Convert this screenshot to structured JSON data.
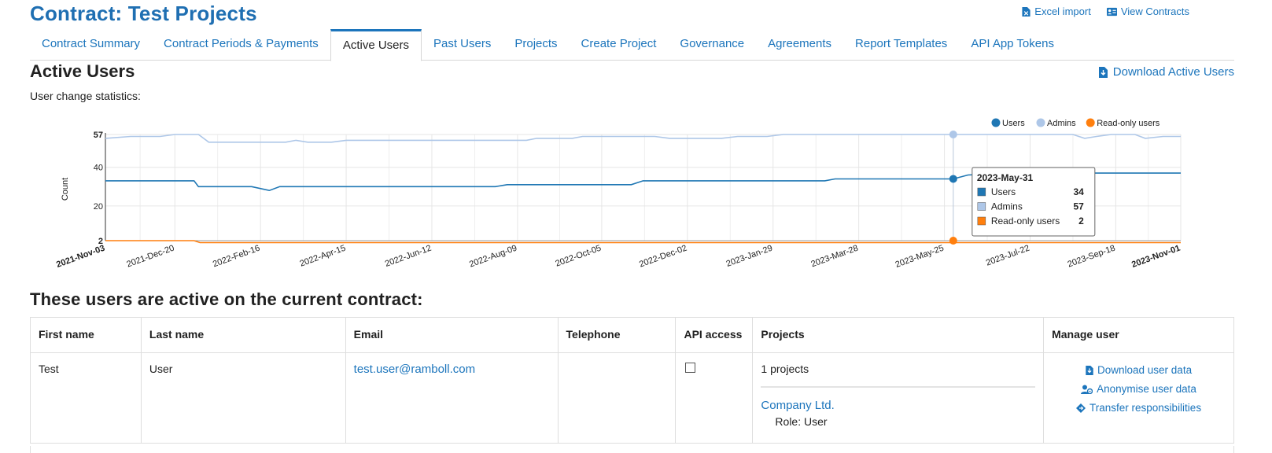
{
  "page": {
    "title": "Contract: Test Projects"
  },
  "top_links": [
    {
      "label": "Excel import",
      "icon": "excel-file-icon"
    },
    {
      "label": "View Contracts",
      "icon": "contracts-card-icon"
    }
  ],
  "tabs": [
    {
      "label": "Contract Summary",
      "active": false
    },
    {
      "label": "Contract Periods & Payments",
      "active": false
    },
    {
      "label": "Active Users",
      "active": true
    },
    {
      "label": "Past Users",
      "active": false
    },
    {
      "label": "Projects",
      "active": false
    },
    {
      "label": "Create Project",
      "active": false
    },
    {
      "label": "Governance",
      "active": false
    },
    {
      "label": "Agreements",
      "active": false
    },
    {
      "label": "Report Templates",
      "active": false
    },
    {
      "label": "API App Tokens",
      "active": false
    }
  ],
  "section": {
    "title": "Active Users",
    "download_label": "Download Active Users",
    "stats_label": "User change statistics:"
  },
  "chart_data": {
    "type": "line",
    "ylabel": "Count",
    "ylim": [
      2,
      57
    ],
    "y_ticks": [
      2,
      20,
      40,
      57
    ],
    "x_tick_labels": [
      "2021-Nov-03",
      "2021-Dec-20",
      "2022-Feb-16",
      "2022-Apr-15",
      "2022-Jun-12",
      "2022-Aug-09",
      "2022-Oct-05",
      "2022-Dec-02",
      "2023-Jan-29",
      "2023-Mar-28",
      "2023-May-25",
      "2023-Jul-22",
      "2023-Sep-18",
      "2023-Nov-01"
    ],
    "bold_ticks": [
      "2021-Nov-03",
      "2023-Nov-01"
    ],
    "legend": "top-right",
    "grid": true,
    "series": [
      {
        "name": "Users",
        "color": "#1f77b4",
        "points": [
          [
            "2021-Nov-03",
            33
          ],
          [
            "2022-Jan-02",
            33
          ],
          [
            "2022-Jan-05",
            30
          ],
          [
            "2022-Feb-10",
            30
          ],
          [
            "2022-Feb-22",
            28
          ],
          [
            "2022-Mar-01",
            30
          ],
          [
            "2022-Jul-25",
            30
          ],
          [
            "2022-Aug-02",
            31
          ],
          [
            "2022-Oct-25",
            31
          ],
          [
            "2022-Nov-02",
            33
          ],
          [
            "2023-Mar-05",
            33
          ],
          [
            "2023-Mar-12",
            34
          ],
          [
            "2023-May-31",
            34
          ],
          [
            "2023-Jun-10",
            36
          ],
          [
            "2023-Jul-10",
            37
          ],
          [
            "2023-Nov-01",
            37
          ]
        ]
      },
      {
        "name": "Admins",
        "color": "#aec7e8",
        "points": [
          [
            "2021-Nov-03",
            55
          ],
          [
            "2021-Nov-20",
            56
          ],
          [
            "2021-Dec-10",
            56
          ],
          [
            "2021-Dec-20",
            57
          ],
          [
            "2022-Jan-05",
            57
          ],
          [
            "2022-Jan-12",
            53
          ],
          [
            "2022-Mar-05",
            53
          ],
          [
            "2022-Mar-12",
            54
          ],
          [
            "2022-Mar-20",
            53
          ],
          [
            "2022-Apr-05",
            53
          ],
          [
            "2022-Apr-15",
            54
          ],
          [
            "2022-Aug-15",
            54
          ],
          [
            "2022-Aug-22",
            55
          ],
          [
            "2022-Sep-15",
            55
          ],
          [
            "2022-Sep-22",
            56
          ],
          [
            "2022-Nov-10",
            56
          ],
          [
            "2022-Nov-20",
            55
          ],
          [
            "2022-Dec-25",
            55
          ],
          [
            "2023-Jan-05",
            56
          ],
          [
            "2023-Jan-25",
            56
          ],
          [
            "2023-Feb-05",
            57
          ],
          [
            "2023-May-31",
            57
          ],
          [
            "2023-Aug-20",
            57
          ],
          [
            "2023-Aug-28",
            55
          ],
          [
            "2023-Sep-05",
            56
          ],
          [
            "2023-Sep-15",
            57
          ],
          [
            "2023-Oct-01",
            57
          ],
          [
            "2023-Oct-08",
            55
          ],
          [
            "2023-Oct-20",
            56
          ],
          [
            "2023-Nov-01",
            56
          ]
        ]
      },
      {
        "name": "Read-only users",
        "color": "#ff7f0e",
        "points": [
          [
            "2021-Nov-03",
            2
          ],
          [
            "2022-Jan-02",
            2
          ],
          [
            "2022-Jan-06",
            1
          ],
          [
            "2023-May-31",
            1
          ],
          [
            "2023-Nov-01",
            1
          ]
        ]
      }
    ],
    "tooltip": {
      "date": "2023-May-31",
      "rows": [
        {
          "label": "Users",
          "value": "34",
          "color": "#1f77b4"
        },
        {
          "label": "Admins",
          "value": "57",
          "color": "#aec7e8"
        },
        {
          "label": "Read-only users",
          "value": "2",
          "color": "#ff7f0e"
        }
      ]
    }
  },
  "table": {
    "heading": "These users are active on the current contract:",
    "columns": [
      "First name",
      "Last name",
      "Email",
      "Telephone",
      "API access",
      "Projects",
      "Manage user"
    ],
    "rows": [
      {
        "first_name": "Test",
        "last_name": "User",
        "email": "test.user@ramboll.com",
        "telephone": "",
        "api_access": false,
        "projects_count": "1 projects",
        "project_name": "Company Ltd.",
        "project_role": "Role: User",
        "actions": [
          {
            "label": "Download user data",
            "icon": "download-file-icon"
          },
          {
            "label": "Anonymise user data",
            "icon": "anonymise-user-icon"
          },
          {
            "label": "Transfer responsibilities",
            "icon": "transfer-diamond-icon"
          }
        ]
      }
    ]
  }
}
